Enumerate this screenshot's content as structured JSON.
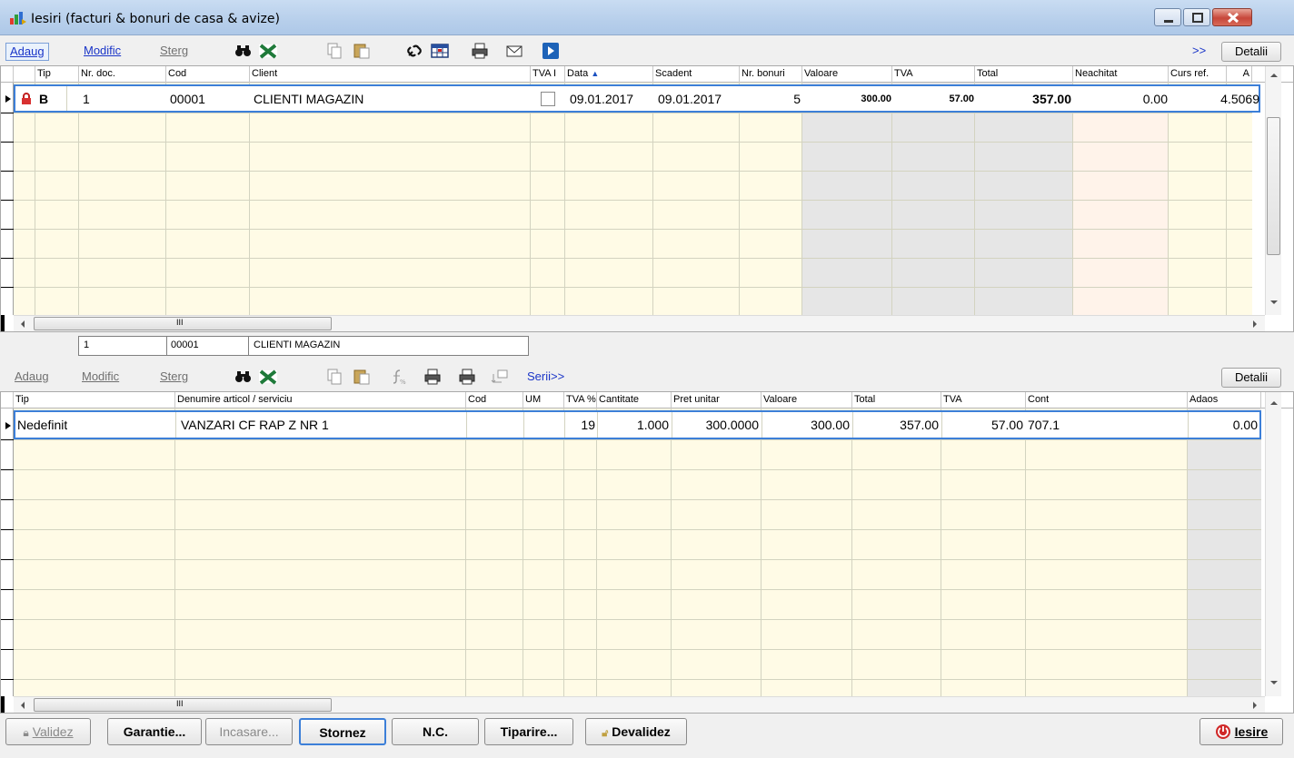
{
  "window": {
    "title": "Iesiri (facturi & bonuri de casa & avize)"
  },
  "top_toolbar": {
    "add": "Adaug",
    "modify": "Modific",
    "delete": "Sterg",
    "more": ">>",
    "details": "Detalii"
  },
  "top_grid": {
    "columns": [
      "Tip",
      "Nr. doc.",
      "Cod",
      "Client",
      "TVA I",
      "Data",
      "Scadent",
      "Nr. bonuri",
      "Valoare",
      "TVA",
      "Total",
      "Neachitat",
      "Curs ref.",
      "A"
    ],
    "row": {
      "tip": "B",
      "nr_doc": "1",
      "cod": "00001",
      "client": "CLIENTI MAGAZIN",
      "data": "09.01.2017",
      "scadent": "09.01.2017",
      "nr_bonuri": "5",
      "valoare": "300.00",
      "tva": "57.00",
      "total": "357.00",
      "neachitat": "0.00",
      "curs_ref": "4.5069"
    },
    "scroll_marker": "III"
  },
  "link_bar": {
    "nr": "1",
    "cod": "00001",
    "client": "CLIENTI MAGAZIN"
  },
  "bottom_toolbar": {
    "add": "Adaug",
    "modify": "Modific",
    "delete": "Sterg",
    "series": "Serii>>",
    "details": "Detalii"
  },
  "bottom_grid": {
    "columns": [
      "Tip",
      "Denumire articol / serviciu",
      "Cod",
      "UM",
      "TVA %",
      "Cantitate",
      "Pret unitar",
      "Valoare",
      "Total",
      "TVA",
      "Cont",
      "Adaos"
    ],
    "row": {
      "tip": "Nedefinit",
      "denumire": "VANZARI CF RAP Z NR 1",
      "cod": "",
      "um": "",
      "tva_pct": "19",
      "cantitate": "1.000",
      "pret_unitar": "300.0000",
      "valoare": "300.00",
      "total": "357.00",
      "tva": "57.00",
      "cont": "707.1",
      "adaos": "0.00"
    },
    "scroll_marker": "III"
  },
  "buttons": {
    "validez": "Validez",
    "garantie": "Garantie...",
    "incasare": "Incasare...",
    "stornez": "Stornez",
    "nc": "N.C.",
    "tiparire": "Tiparire...",
    "devalidez": "Devalidez",
    "iesire": "Iesire"
  },
  "colors": {
    "grid_background": "#fffbe6",
    "grey_column": "#e6e6e6",
    "pink_column": "#fff3ea",
    "selection_border": "#3c7fd8",
    "link_blue": "#1a35c8"
  }
}
